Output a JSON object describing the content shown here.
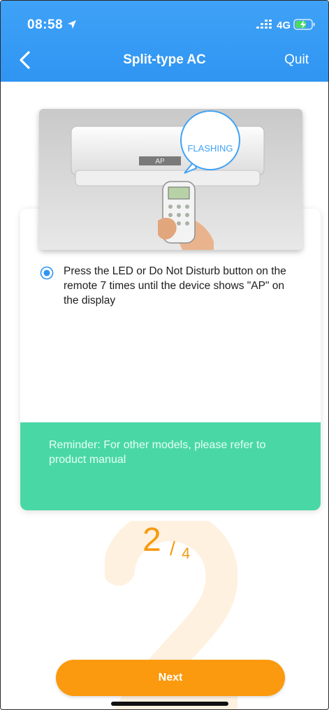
{
  "status_bar": {
    "time": "08:58",
    "network": "4G",
    "icons": [
      "location-arrow-icon",
      "signal-icon",
      "battery-charging-icon"
    ]
  },
  "nav": {
    "back_icon": "chevron-left-icon",
    "title": "Split-type AC",
    "quit_label": "Quit"
  },
  "illustration": {
    "flashing_label": "FLASHING",
    "display_label": "AP"
  },
  "instruction": {
    "selected": true,
    "text": "Press the LED or Do Not Disturb button on the remote 7 times until the device shows \"AP\" on the display"
  },
  "reminder": {
    "text": "Reminder: For other models, please refer to product manual"
  },
  "progress": {
    "current": "2",
    "separator": "/",
    "total": "4"
  },
  "next_label": "Next",
  "colors": {
    "header": "#3fa2f7",
    "accent_orange": "#fb9a0e",
    "reminder_bg": "#49d8a5",
    "radio": "#2f95f2"
  }
}
